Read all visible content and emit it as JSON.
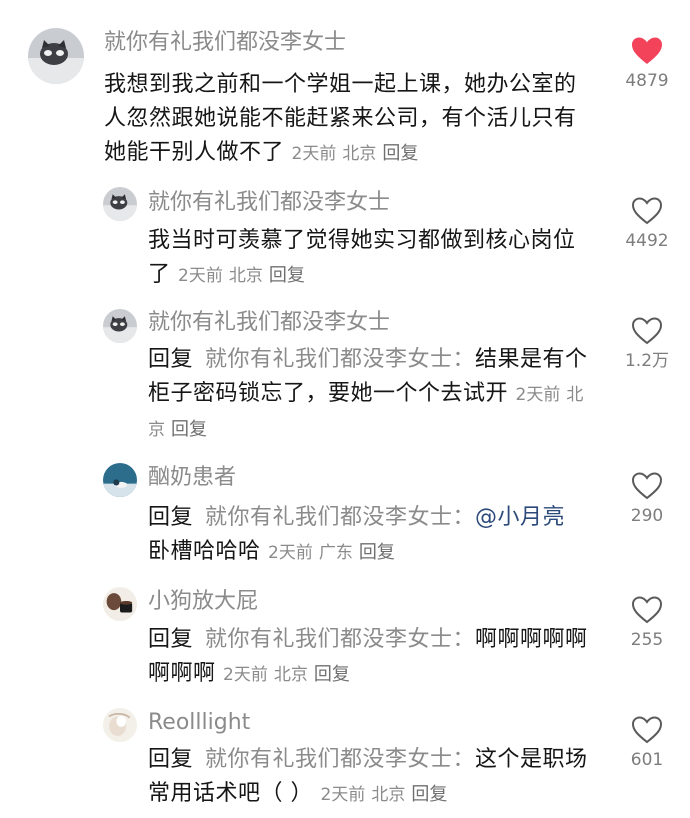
{
  "meta": {
    "time": "2天前",
    "location": "北京",
    "location_gd": "广东",
    "reply_action": "回复"
  },
  "colors": {
    "liked_heart": "#f2435b",
    "mention": "#2c4a7a"
  },
  "comments": [
    {
      "username": "就你有礼我们都没李女士",
      "text": "我想到我之前和一个学姐一起上课，她办公室的人忽然跟她说能不能赶紧来公司，有个活儿只有她能干别人做不了",
      "time": "2天前",
      "location": "北京",
      "reply_action": "回复",
      "likes": "4879",
      "liked": true
    },
    {
      "username": "就你有礼我们都没李女士",
      "text": "我当时可羡慕了觉得她实习都做到核心岗位了",
      "time": "2天前",
      "location": "北京",
      "reply_action": "回复",
      "likes": "4492",
      "liked": false
    },
    {
      "username": "就你有礼我们都没李女士",
      "reply_prefix": "回复",
      "reply_to": "就你有礼我们都没李女士：",
      "text": "结果是有个柜子密码锁忘了，要她一个个去试开",
      "time": "2天前",
      "location": "北京",
      "reply_action": "回复",
      "likes": "1.2万",
      "liked": false
    },
    {
      "username": "酗奶患者",
      "reply_prefix": "回复",
      "reply_to": "就你有礼我们都没李女士：",
      "mention": "@小月亮",
      "text": " 卧槽哈哈哈",
      "time": "2天前",
      "location": "广东",
      "reply_action": "回复",
      "likes": "290",
      "liked": false
    },
    {
      "username": "小狗放大屁",
      "reply_prefix": "回复",
      "reply_to": "就你有礼我们都没李女士：",
      "text": "啊啊啊啊啊啊啊啊",
      "time": "2天前",
      "location": "北京",
      "reply_action": "回复",
      "likes": "255",
      "liked": false
    },
    {
      "username": "Reolllight",
      "reply_prefix": "回复",
      "reply_to": "就你有礼我们都没李女士：",
      "text": "这个是职场常用话术吧（ ）",
      "time": "2天前",
      "location": "北京",
      "reply_action": "回复",
      "likes": "601",
      "liked": false
    }
  ]
}
